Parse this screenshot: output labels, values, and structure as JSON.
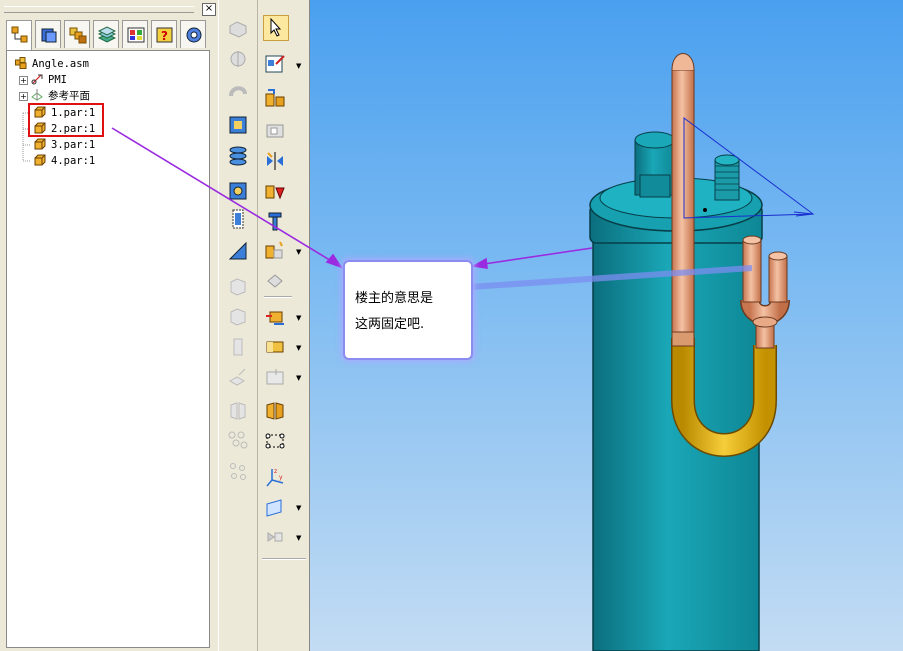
{
  "pane": {
    "close_glyph": "×"
  },
  "tabs": [
    {
      "icon": "assembly-pathfinder-icon"
    },
    {
      "icon": "parts-library-icon"
    },
    {
      "icon": "family-of-assemblies-icon"
    },
    {
      "icon": "layers-icon"
    },
    {
      "icon": "feature-library-icon"
    },
    {
      "icon": "help-icon"
    },
    {
      "icon": "engineering-reference-icon"
    }
  ],
  "tree": {
    "root": "Angle.asm",
    "pmi": "PMI",
    "ref_planes": "参考平面",
    "parts": [
      "1.par:1",
      "2.par:1",
      "3.par:1",
      "4.par:1"
    ]
  },
  "callout": {
    "line1": "楼主的意思是",
    "line2": "这两固定吧."
  },
  "colors": {
    "highlight_box": "#e01010",
    "arrow": "#9a2be0",
    "callout_border": "#8a8cf0",
    "body": "#1a99a9",
    "copper": "#e9a47e",
    "gold": "#e3b31c"
  }
}
